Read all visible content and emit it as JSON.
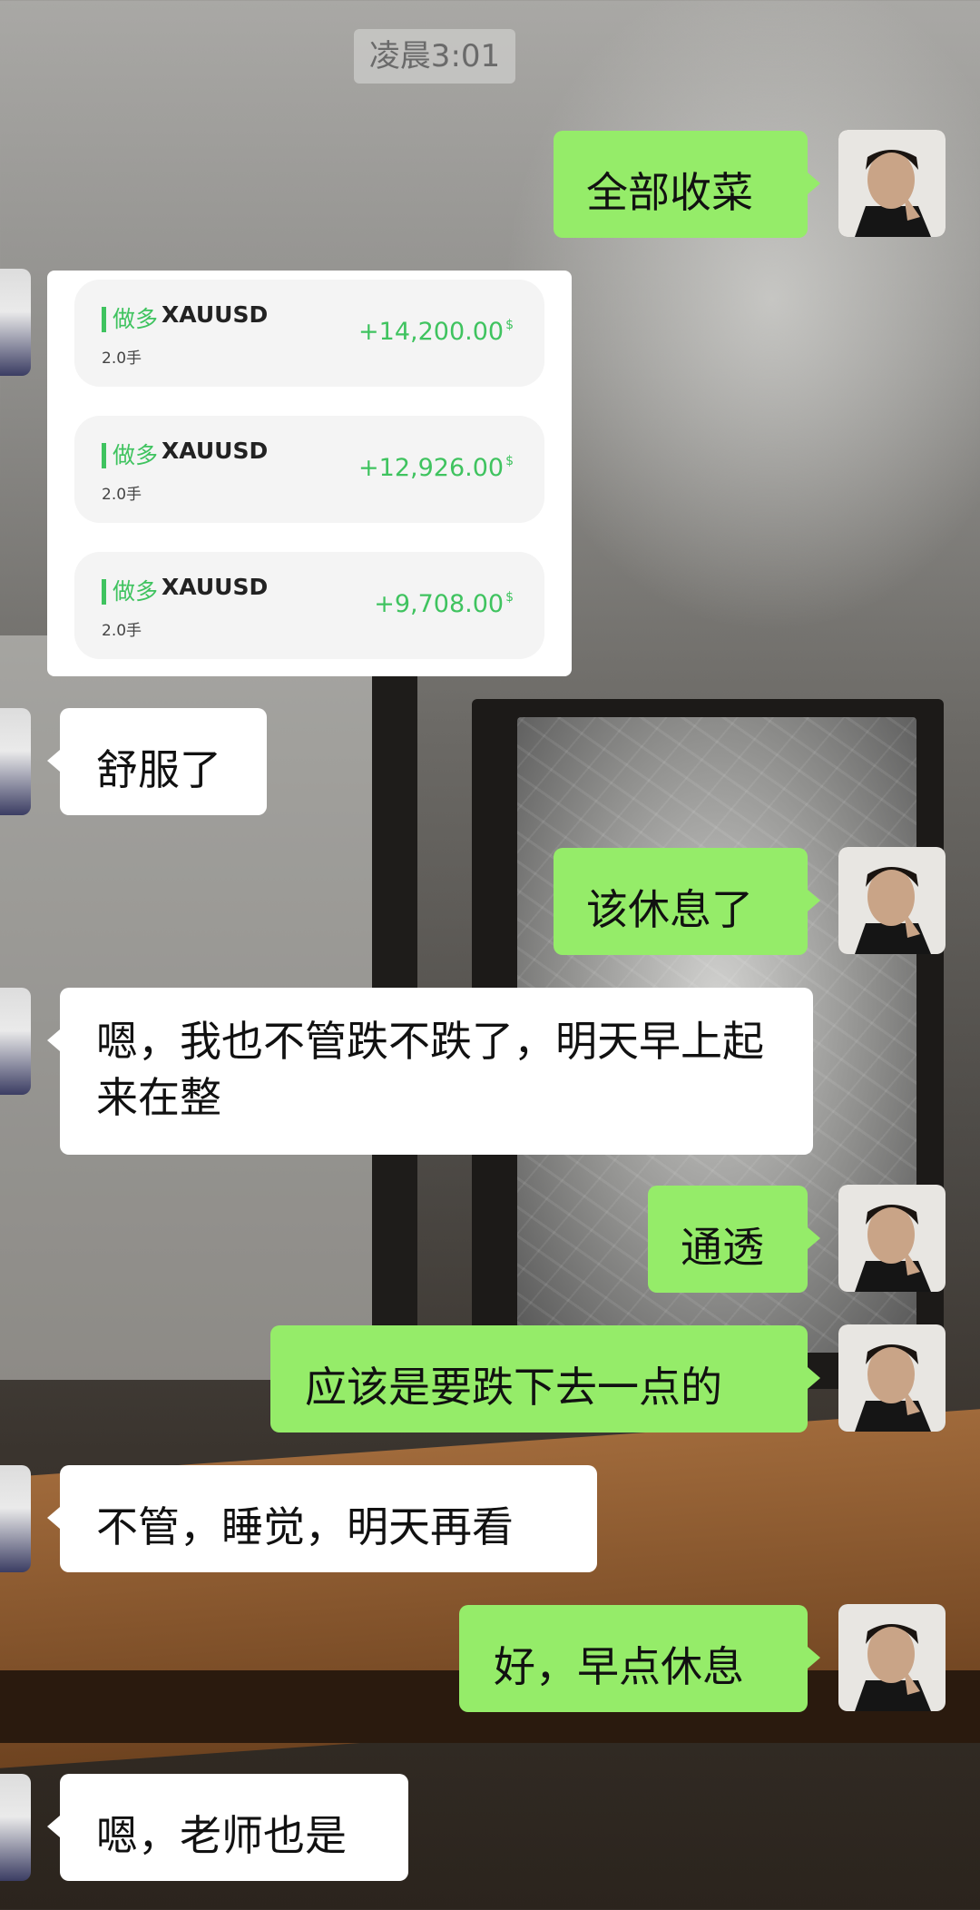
{
  "timestamp": "凌晨3:01",
  "trades": [
    {
      "direction": "做多",
      "symbol": "XAUUSD",
      "lots": "2.0手",
      "profit": "+14,200.00",
      "unit": "$"
    },
    {
      "direction": "做多",
      "symbol": "XAUUSD",
      "lots": "2.0手",
      "profit": "+12,926.00",
      "unit": "$"
    },
    {
      "direction": "做多",
      "symbol": "XAUUSD",
      "lots": "2.0手",
      "profit": "+9,708.00",
      "unit": "$"
    }
  ],
  "messages": [
    {
      "sender": "me",
      "text": "全部收菜"
    },
    {
      "sender": "them",
      "text": "舒服了"
    },
    {
      "sender": "me",
      "text": "该休息了"
    },
    {
      "sender": "them",
      "text": "嗯，我也不管跌不跌了，明天早上起来在整"
    },
    {
      "sender": "me",
      "text": "通透"
    },
    {
      "sender": "me",
      "text": "应该是要跌下去一点的"
    },
    {
      "sender": "them",
      "text": "不管，睡觉，明天再看"
    },
    {
      "sender": "me",
      "text": "好，早点休息"
    },
    {
      "sender": "them",
      "text": "嗯，老师也是"
    }
  ],
  "colors": {
    "my_bubble": "#95ec69",
    "their_bubble": "#ffffff",
    "profit": "#3fc35f"
  }
}
